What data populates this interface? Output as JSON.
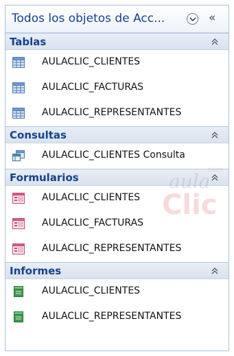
{
  "pane": {
    "title": "Todos los objetos de Acc...",
    "collapse_glyph": "«"
  },
  "groups": [
    {
      "title": "Tablas",
      "icon": "table-icon",
      "items": [
        "AULACLIC_CLIENTES",
        "AULACLIC_FACTURAS",
        "AULACLIC_REPRESENTANTES"
      ]
    },
    {
      "title": "Consultas",
      "icon": "query-icon",
      "items": [
        "AULACLIC_CLIENTES Consulta"
      ]
    },
    {
      "title": "Formularios",
      "icon": "form-icon",
      "items": [
        "AULACLIC_CLIENTES",
        "AULACLIC_FACTURAS",
        "AULACLIC_REPRESENTANTES"
      ]
    },
    {
      "title": "Informes",
      "icon": "report-icon",
      "items": [
        "AULACLIC_CLIENTES",
        "AULACLIC_REPRESENTANTES"
      ]
    }
  ],
  "watermark": {
    "line1": "aula",
    "line2": "Clic",
    "suffix": ".com"
  },
  "colors": {
    "accent": "#15428b",
    "border": "#a9bfd6"
  }
}
